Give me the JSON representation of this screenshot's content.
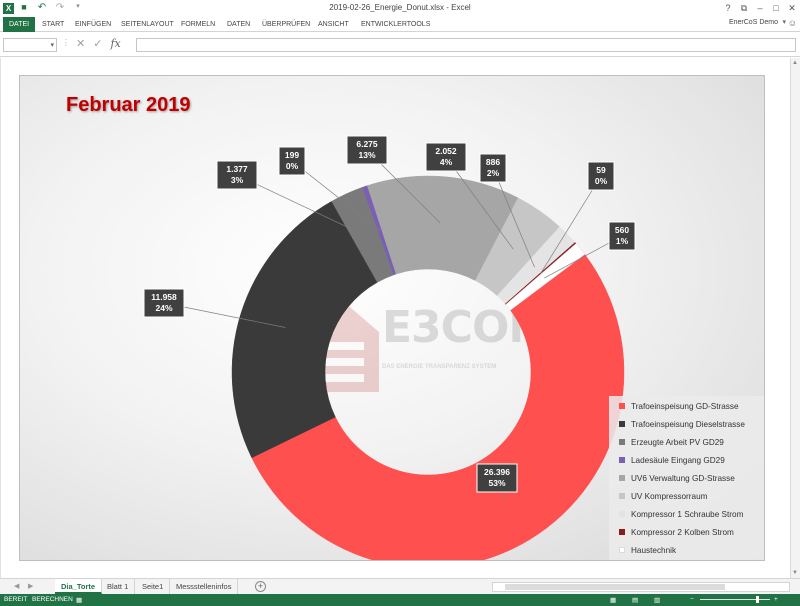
{
  "window": {
    "title": "2019-02-26_Energie_Donut.xlsx - Excel",
    "help": "?",
    "ribbon_display": "⧉",
    "minimize": "–",
    "maximize": "□",
    "close": "✕"
  },
  "qat": {
    "app_icon": "X",
    "save": "💾",
    "undo": "↶",
    "redo": "↷",
    "customize": "▾"
  },
  "ribbon": {
    "tabs": [
      "DATEI",
      "START",
      "EINFÜGEN",
      "SEITENLAYOUT",
      "FORMELN",
      "DATEN",
      "ÜBERPRÜFEN",
      "ANSICHT",
      "ENTWICKLERTOOLS"
    ],
    "user": "EnerCoS Demo"
  },
  "formula_bar": {
    "name_box": "",
    "formula": "",
    "cancel_icon": "✕",
    "enter_icon": "✓",
    "fx_label": "fx"
  },
  "chart": {
    "title": "Februar 2019",
    "watermark_brand": "E3CON",
    "watermark_slogan": "DAS ENERGIE TRANSPARENZ SYSTEM"
  },
  "chart_data": {
    "type": "donut",
    "title": "Februar 2019",
    "legend_position": "bottom-right",
    "series": [
      {
        "name": "Trafoeinspeisung GD-Strasse",
        "value": 26396,
        "value_label": "26.396",
        "percent_label": "53%",
        "color": "#ff5050"
      },
      {
        "name": "Trafoeinspeisung Dieselstrasse",
        "value": 11958,
        "value_label": "11.958",
        "percent_label": "24%",
        "color": "#3a3a3a"
      },
      {
        "name": "Erzeugte Arbeit PV GD29",
        "value": 1377,
        "value_label": "1.377",
        "percent_label": "3%",
        "color": "#7a7a7a"
      },
      {
        "name": "Ladesäule Eingang GD29",
        "value": 199,
        "value_label": "199",
        "percent_label": "0%",
        "color": "#7b5fb5"
      },
      {
        "name": "UV6 Verwaltung GD-Strasse",
        "value": 6275,
        "value_label": "6.275",
        "percent_label": "13%",
        "color": "#a6a6a6"
      },
      {
        "name": "UV Kompressorraum",
        "value": 2052,
        "value_label": "2.052",
        "percent_label": "4%",
        "color": "#c6c6c6"
      },
      {
        "name": "Kompressor 1 Schraube Strom",
        "value": 886,
        "value_label": "886",
        "percent_label": "2%",
        "color": "#e4e4e4"
      },
      {
        "name": "Kompressor 2 Kolben Strom",
        "value": 59,
        "value_label": "59",
        "percent_label": "0%",
        "color": "#8b1a1a"
      },
      {
        "name": "Haustechnik",
        "value": 560,
        "value_label": "560",
        "percent_label": "1%",
        "color": "#ffffff"
      }
    ]
  },
  "sheet_tabs": {
    "tabs": [
      "Dia_Torte",
      "Blatt 1",
      "Seite1",
      "Messstelleninfos"
    ],
    "active": "Dia_Torte",
    "add_label": "+"
  },
  "status_bar": {
    "ready": "BEREIT",
    "calc": "BERECHNEN"
  }
}
